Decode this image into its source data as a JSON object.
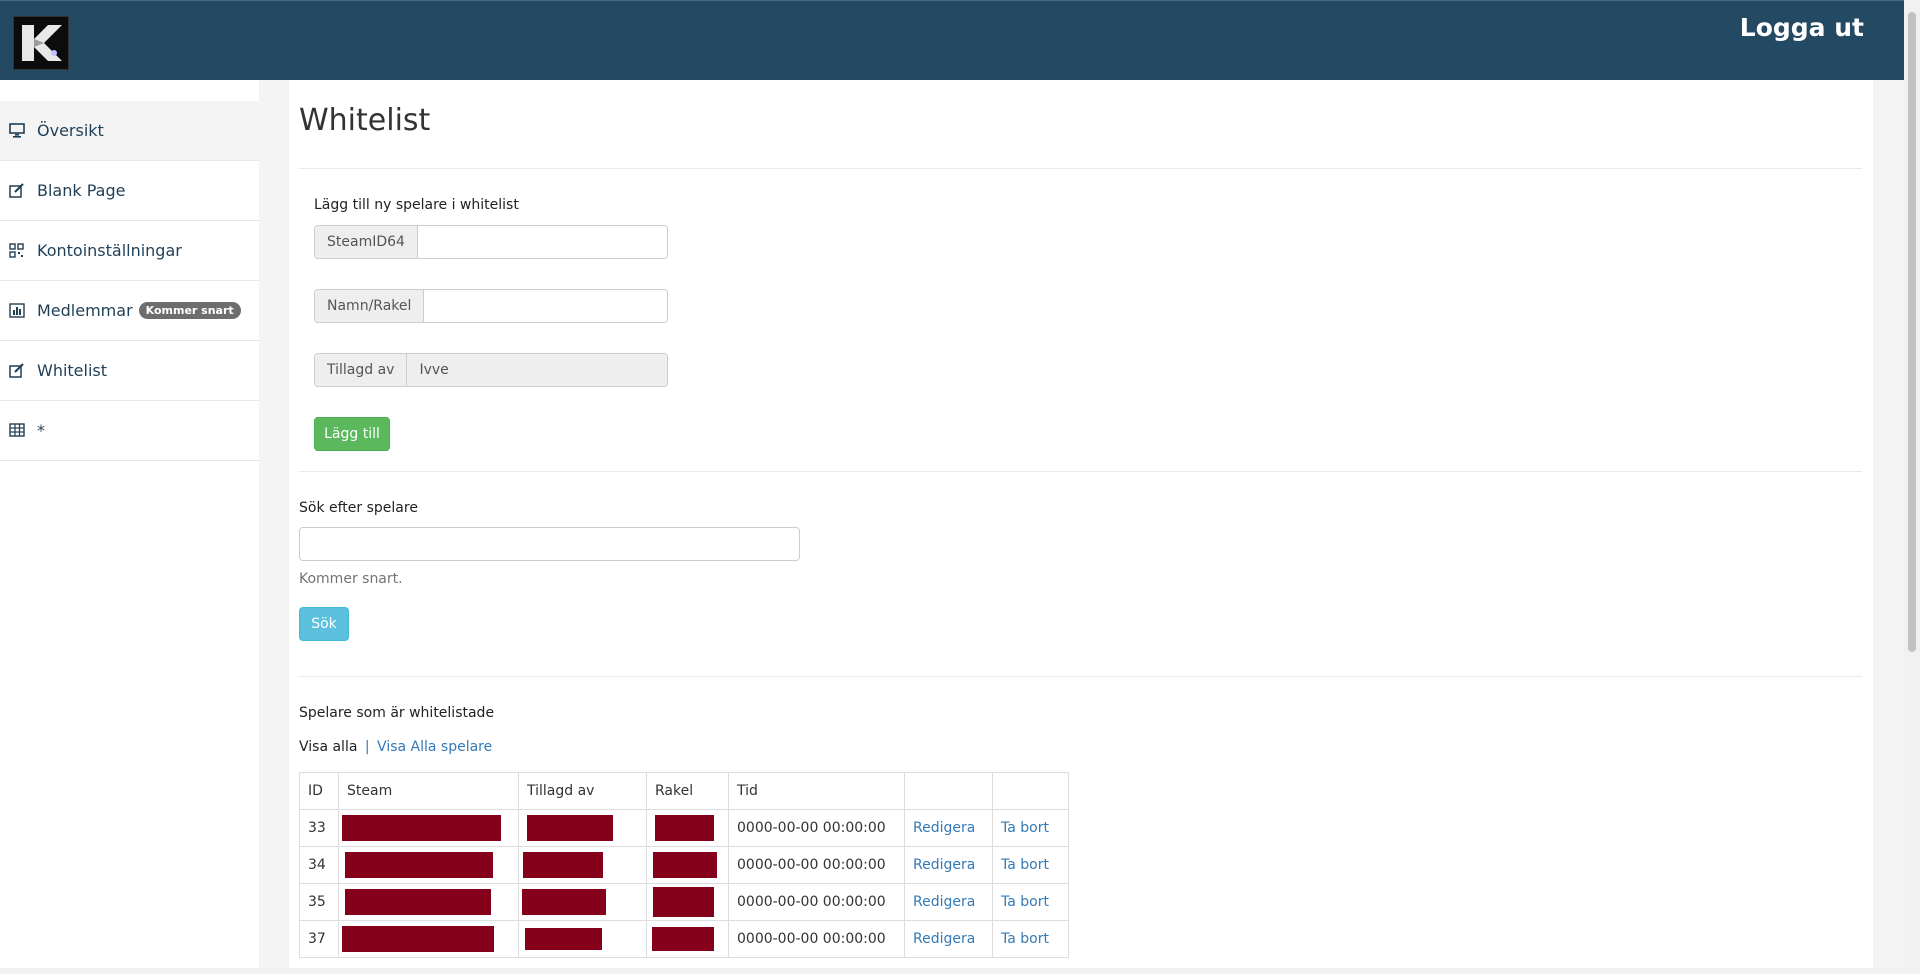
{
  "header": {
    "logout_label": "Logga ut"
  },
  "sidebar": {
    "items": [
      {
        "label": "Översikt",
        "icon": "monitor-icon"
      },
      {
        "label": "Blank Page",
        "icon": "edit-icon"
      },
      {
        "label": "Kontoinställningar",
        "icon": "qr-icon"
      },
      {
        "label": "Medlemmar",
        "icon": "bar-chart-icon",
        "badge": "Kommer snart"
      },
      {
        "label": "Whitelist",
        "icon": "edit-icon"
      },
      {
        "label": "*",
        "icon": "table-icon"
      }
    ]
  },
  "page": {
    "title": "Whitelist"
  },
  "add_form": {
    "heading": "Lägg till ny spelare i whitelist",
    "steamid_label": "SteamID64",
    "steamid_value": "",
    "name_label": "Namn/Rakel",
    "name_value": "",
    "added_by_label": "Tillagd av",
    "added_by_value": "Ivve",
    "submit_label": "Lägg till"
  },
  "search_form": {
    "heading": "Sök efter spelare",
    "value": "",
    "help": "Kommer snart.",
    "submit_label": "Sök"
  },
  "list": {
    "heading": "Spelare som är whitelistade",
    "view_all": "Visa alla",
    "separator": "|",
    "view_all_players": "Visa Alla spelare",
    "columns": [
      "ID",
      "Steam",
      "Tillagd av",
      "Rakel",
      "Tid",
      "",
      ""
    ],
    "rows": [
      {
        "id": "33",
        "time": "0000-00-00 00:00:00",
        "edit": "Redigera",
        "delete": "Ta bort"
      },
      {
        "id": "34",
        "time": "0000-00-00 00:00:00",
        "edit": "Redigera",
        "delete": "Ta bort"
      },
      {
        "id": "35",
        "time": "0000-00-00 00:00:00",
        "edit": "Redigera",
        "delete": "Ta bort"
      },
      {
        "id": "37",
        "time": "0000-00-00 00:00:00",
        "edit": "Redigera",
        "delete": "Ta bort"
      }
    ]
  },
  "colors": {
    "header_bg": "#244963",
    "redaction": "#85001a",
    "success": "#5cb85c",
    "info": "#5bc0de",
    "link": "#337ab7"
  }
}
